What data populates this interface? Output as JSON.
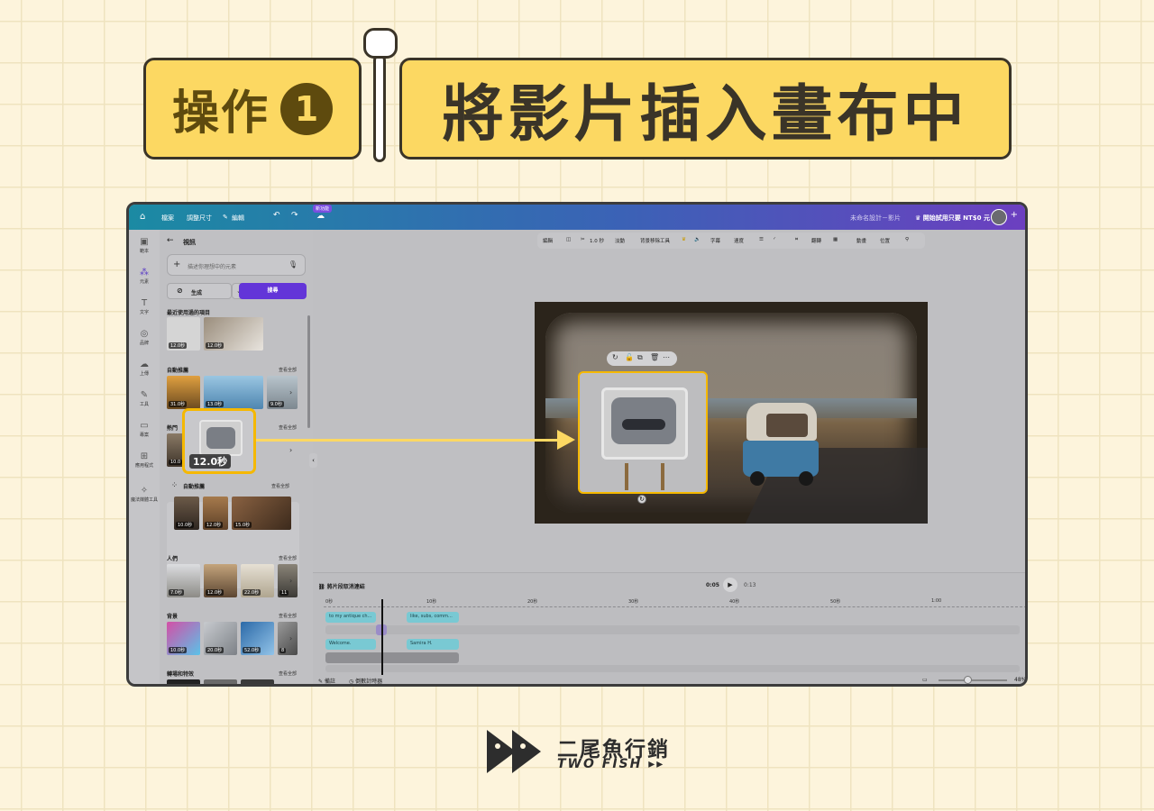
{
  "banner": {
    "step_label": "操作",
    "step_number": "1",
    "title": "將影片插入畫布中"
  },
  "topbar": {
    "home": "⌂",
    "menu_file": "檔案",
    "menu_resize": "調整尺寸",
    "menu_edit": "編輯",
    "new_badge": "新功能",
    "design_name": "未命名設計－影片",
    "upgrade": "開始試用只要 NT$0 元",
    "add": "+"
  },
  "rail": {
    "items": [
      "範本",
      "元素",
      "文字",
      "品牌",
      "上傳",
      "工具",
      "專案",
      "應用程式",
      "魔法媒體工具"
    ]
  },
  "side_panel": {
    "title": "視訊",
    "search_placeholder": "描述你理想中的元素",
    "generate": "生成",
    "search": "搜尋",
    "recent": "最近使用過的項目",
    "auto_recommend": "自動推薦",
    "hot": "熱門",
    "sub_auto": "自動推薦",
    "people": "人們",
    "background": "背景",
    "transitions": "轉場和特效",
    "see_all": "查看全部",
    "durations": {
      "recent": [
        "12.0秒",
        "12.0秒"
      ],
      "auto": [
        "31.0秒",
        "13.0秒",
        "9.0秒"
      ],
      "hot_first": "10.0",
      "sub_auto": [
        "10.0秒",
        "12.0秒",
        "15.0秒"
      ],
      "people": [
        "7.0秒",
        "12.0秒",
        "22.0秒",
        "11"
      ],
      "background": [
        "10.0秒",
        "20.0秒",
        "52.0秒",
        "8"
      ]
    }
  },
  "toolbar": {
    "items": [
      "編輯",
      "1.0 秒",
      "淡動",
      "背景移除工具",
      "字幕",
      "速度",
      "翻轉",
      "動畫",
      "位置"
    ]
  },
  "timeline": {
    "link_label": "將片段取消連結",
    "current": "0:05",
    "total": "0:13",
    "ticks": [
      "0秒",
      "10秒",
      "20秒",
      "30秒",
      "40秒",
      "50秒",
      "1:00"
    ],
    "clips": [
      "to my antique ch...",
      "like, subs, comm...",
      "Welcome.",
      "Samira H."
    ],
    "notes": "備註",
    "timer": "倒數計時器",
    "zoom": "48%"
  },
  "overlay": {
    "drag_duration": "12.0秒"
  },
  "logo": {
    "chinese": "二尾魚行銷",
    "english": "TWO FISH ▸▸"
  },
  "colors": {
    "background": "#fdf4dc",
    "banner_yellow": "#fcd862",
    "highlight": "#f5b800",
    "accent_purple": "#6335d8"
  }
}
